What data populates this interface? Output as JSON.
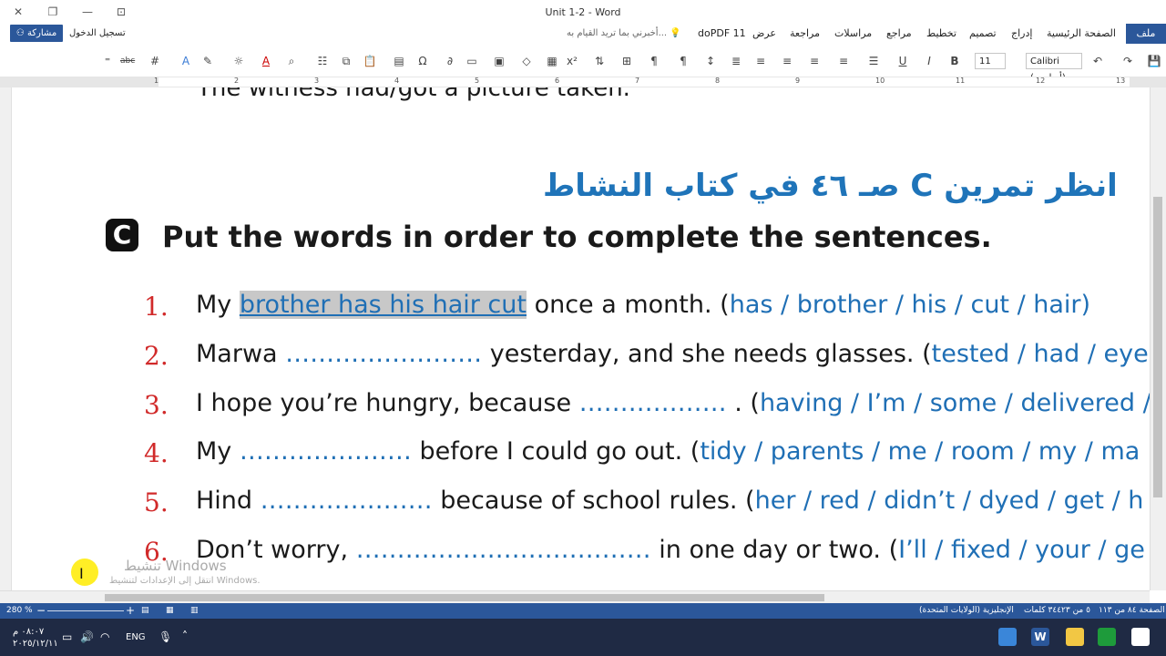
{
  "window": {
    "title": "Unit 1-2 - Word",
    "close_glyph": "✕",
    "restore_glyph": "❐",
    "minimize_glyph": "—",
    "ribbon_toggle_glyph": "⊡"
  },
  "tabs": {
    "file": "ملف",
    "home": "الصفحة الرئيسية",
    "insert": "إدراج",
    "design": "تصميم",
    "layout": "تخطيط",
    "references": "مراجع",
    "mailings": "مراسلات",
    "review": "مراجعة",
    "view": "عرض",
    "dopdf": "doPDF 11",
    "tell_me": "أخبرني بما تريد القيام به..."
  },
  "account": {
    "share": "مشاركة",
    "sign_in": "تسجيل الدخول"
  },
  "ribbon": {
    "font_name": "Calibri (أساسي)",
    "font_size": "11"
  },
  "ruler": {
    "numbers": [
      "13",
      "12",
      "11",
      "10",
      "9",
      "8",
      "7",
      "6",
      "5",
      "4",
      "3",
      "2",
      "1"
    ]
  },
  "document": {
    "top_clipped": "The witness had/got a picture taken.",
    "arabic_title": "انظر تمرين C صـ ٤٦ في كتاب النشاط",
    "badge": "C",
    "instruction": "Put the words in order to complete the sentences.",
    "items": [
      {
        "num": "1.",
        "pre": "My ",
        "answer": "brother has his hair cut",
        "post": " once a month. (",
        "words": "has / brother / his / cut / hair)"
      },
      {
        "num": "2.",
        "pre": "Marwa ",
        "blank": "…………………… ",
        "post": "yesterday, and she needs glasses. (",
        "words": "tested / had / eyes"
      },
      {
        "num": "3.",
        "pre": "I hope you’re hungry, because ",
        "blank": "……………… ",
        "post": ". (",
        "words": "having / I’m / some / delivered /"
      },
      {
        "num": "4.",
        "pre": "My ",
        "blank": "………………… ",
        "post": "before I could go out. (",
        "words": "tidy / parents / me / room / my / ma"
      },
      {
        "num": "5.",
        "pre": "Hind ",
        "blank": "………………… ",
        "post": "because of school rules. (",
        "words": "her / red / didn’t / dyed / get / h"
      },
      {
        "num": "6.",
        "pre": "Don’t worry, ",
        "blank": "……………………………… ",
        "post": "in one day or two. (",
        "words": "I’ll / fixed / your / ge"
      }
    ]
  },
  "watermark": {
    "line1": "تنشيط Windows",
    "line2": "انتقل إلى الإعدادات لتنشيط Windows."
  },
  "status": {
    "zoom": "280 %",
    "page": "الصفحة ٨٤ من ١١٣",
    "words": "٥ من ٣٤٤٢٣ كلمات",
    "language": "الإنجليزية (الولايات المتحدة)"
  },
  "taskbar": {
    "time": "٠٨:٠٧ م",
    "date": "٢٠٢٥/١٢/١١",
    "lang": "ENG"
  },
  "colors": {
    "word_blue": "#2b579a",
    "answer_blue": "#1f6fb5",
    "number_red": "#d12a2a",
    "taskbar": "#1f2a44"
  }
}
